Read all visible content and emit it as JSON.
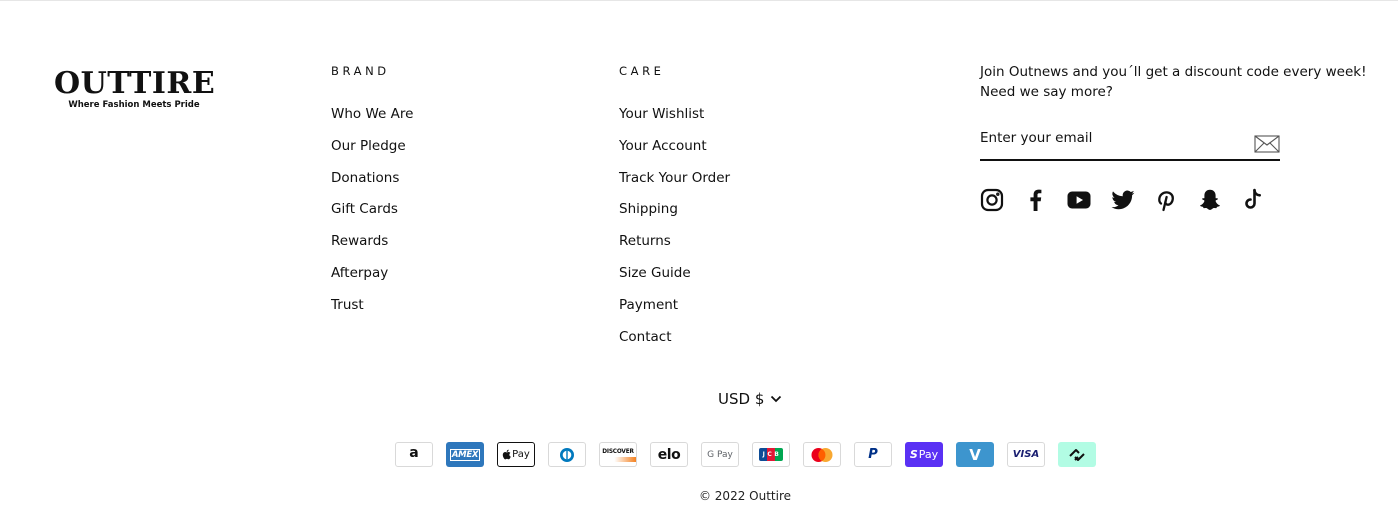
{
  "logo": {
    "name": "OUTTIRE",
    "tagline": "Where Fashion Meets Pride"
  },
  "brand_column": {
    "heading": "BRAND",
    "links": [
      "Who We Are",
      "Our Pledge",
      "Donations",
      "Gift Cards",
      "Rewards",
      "Afterpay",
      "Trust"
    ]
  },
  "care_column": {
    "heading": "CARE",
    "links": [
      "Your Wishlist",
      "Your Account",
      "Track Your Order",
      "Shipping",
      "Returns",
      "Size Guide",
      "Payment",
      "Contact"
    ]
  },
  "newsletter": {
    "text": "Join Outnews and you´ll get a discount code every week! Need we say more?",
    "placeholder": "Enter your email",
    "submit_icon": "envelope-icon"
  },
  "social_icons": [
    "instagram-icon",
    "facebook-icon",
    "youtube-icon",
    "twitter-icon",
    "pinterest-icon",
    "snapchat-icon",
    "tiktok-icon"
  ],
  "currency": {
    "label": "USD $"
  },
  "payment_methods": {
    "amazon": "a",
    "amex": "AMEX",
    "apple_pay": "Pay",
    "diners": "",
    "discover": "DISCOVER",
    "elo": "elo",
    "google_pay": "G Pay",
    "jcb": "JCB",
    "mastercard": "",
    "paypal": "P",
    "shop_pay": "Pay",
    "venmo": "V",
    "visa": "VISA",
    "afterpay": ""
  },
  "colors": {
    "amex": "#2E77BC",
    "shop_pay": "#5A31F4",
    "venmo": "#3D95CE",
    "afterpay": "#B2FCE4",
    "mastercard_red": "#EB001B",
    "mastercard_orange": "#F79E1B",
    "visa": "#1A1F71"
  },
  "copyright": "© 2022 Outtire"
}
